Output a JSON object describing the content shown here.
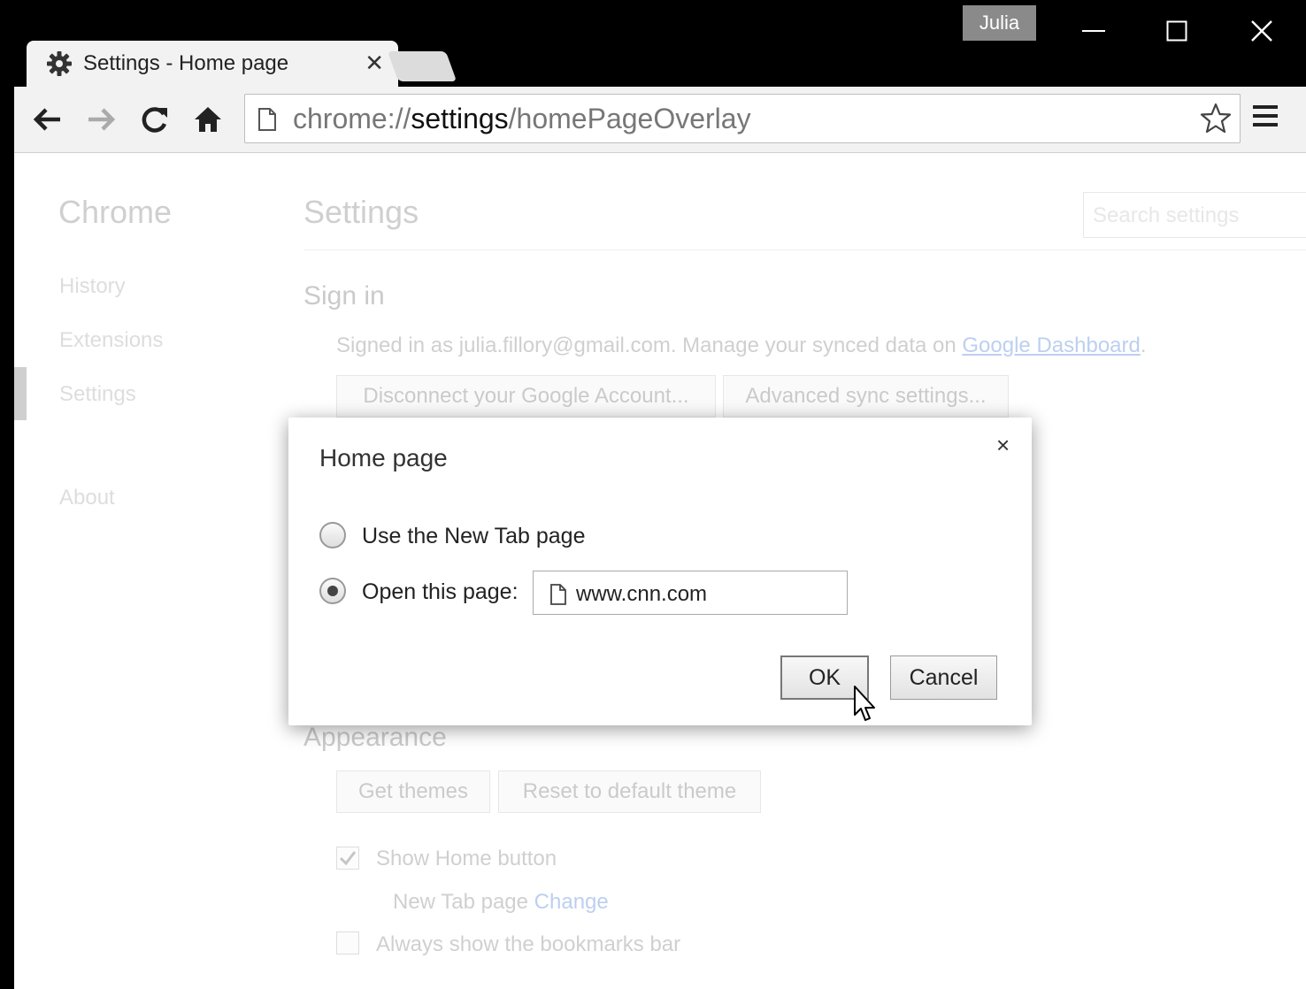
{
  "titlebar": {
    "profile_name": "Julia",
    "tab_title": "Settings - Home page",
    "tab_close": "✕",
    "window_buttons": [
      "minimize-icon",
      "maximize-icon",
      "close-icon"
    ]
  },
  "toolbar": {
    "url_prefix": "chrome://",
    "url_host": "settings",
    "url_path": "/homePageOverlay",
    "menu_icon": "hamburger-menu-icon"
  },
  "sidebar": {
    "title": "Chrome",
    "items": [
      {
        "label": "History"
      },
      {
        "label": "Extensions"
      },
      {
        "label": "Settings"
      },
      {
        "label": "About"
      }
    ]
  },
  "main": {
    "title": "Settings",
    "search_placeholder": "Search settings",
    "signin": {
      "heading": "Sign in",
      "text_before": "Signed in as julia.fillory@gmail.com. Manage your synced data on ",
      "link": "Google Dashboard",
      "text_after": ".",
      "disconnect_button": "Disconnect your Google Account...",
      "advanced_button": "Advanced sync settings..."
    },
    "appearance": {
      "heading": "Appearance",
      "get_themes": "Get themes",
      "reset_theme": "Reset to default theme",
      "show_home_label": "Show Home button",
      "show_home_checked": true,
      "home_sub_text": "New Tab page",
      "home_sub_link": "Change",
      "bookmarks_label": "Always show the bookmarks bar",
      "bookmarks_checked": false
    }
  },
  "dialog": {
    "title": "Home page",
    "close": "×",
    "option_newtab": "Use the New Tab page",
    "option_open": "Open this page:",
    "selected": "open",
    "url_value": "www.cnn.com",
    "ok": "OK",
    "cancel": "Cancel"
  }
}
